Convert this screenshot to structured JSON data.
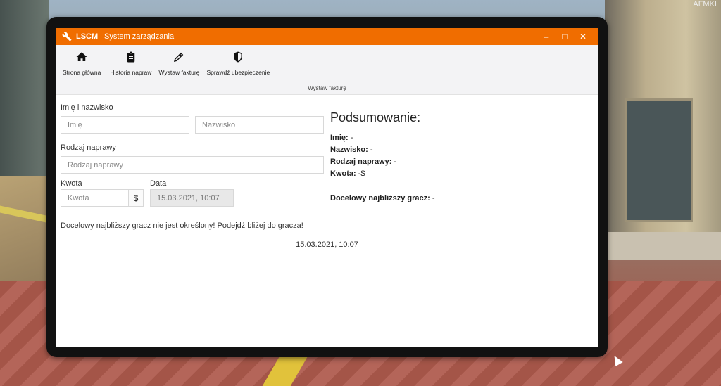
{
  "window": {
    "app_name": "LSCM",
    "separator": "|",
    "subtitle": "System zarządzania",
    "controls": [
      "–",
      "□",
      "✕"
    ]
  },
  "toolbar": {
    "items": [
      {
        "label": "Strona główna",
        "icon": "home-icon"
      },
      {
        "label": "Historia napraw",
        "icon": "clipboard-icon"
      },
      {
        "label": "Wystaw fakturę",
        "icon": "pencil-icon"
      },
      {
        "label": "Sprawdź ubezpieczenie",
        "icon": "shield-icon"
      }
    ]
  },
  "page_title": "Wystaw fakturę",
  "form": {
    "name_label": "Imię i nazwisko",
    "first_name_placeholder": "Imię",
    "last_name_placeholder": "Nazwisko",
    "repair_label": "Rodzaj naprawy",
    "repair_placeholder": "Rodzaj naprawy",
    "amount_label": "Kwota",
    "amount_placeholder": "Kwota",
    "currency_symbol": "$",
    "date_label": "Data",
    "date_value": "15.03.2021, 10:07"
  },
  "notice": "Docelowy najbliższy gracz nie jest określony! Podejdź bliżej do gracza!",
  "timestamp": "15.03.2021, 10:07",
  "summary": {
    "title": "Podsumowanie:",
    "first_name_key": "Imię:",
    "first_name_val": " -",
    "last_name_key": "Nazwisko:",
    "last_name_val": " -",
    "repair_key": "Rodzaj naprawy:",
    "repair_val": " -",
    "amount_key": "Kwota:",
    "amount_val": " -$",
    "target_key": "Docelowy najbliższy gracz:",
    "target_val": " -"
  },
  "background": {
    "corner_tag": "AFMKI"
  },
  "colors": {
    "titlebar": "#f06d00",
    "toolbar": "#f3f3f5"
  }
}
